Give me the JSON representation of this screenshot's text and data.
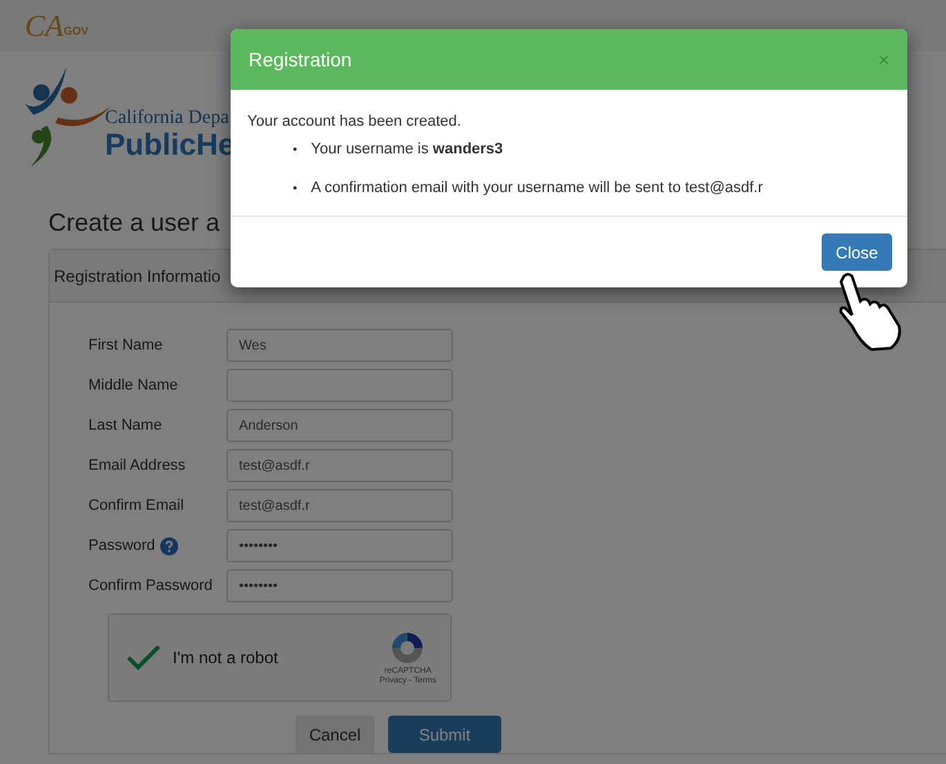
{
  "header": {
    "logo_text": "CA",
    "logo_subtext": "GOV"
  },
  "brand": {
    "line1": "California Depa",
    "line2": "PublicHe"
  },
  "page_title": "Create a user a",
  "panel": {
    "title": "Registration Informatio",
    "fields": [
      {
        "label": "First Name",
        "value": "Wes",
        "help_icon": false
      },
      {
        "label": "Middle Name",
        "help_icon": false
      },
      {
        "label": "Last Name",
        "value": "Anderson",
        "help_icon": false
      },
      {
        "label": "Email Address",
        "value": "test@asdf.r",
        "help_icon": false
      },
      {
        "label": "Confirm Email",
        "value": "test@asdf.r",
        "help_icon": false
      },
      {
        "label": "Password",
        "value": "••••••••",
        "help_icon": true
      },
      {
        "label": "Confirm Password",
        "value": "••••••••",
        "help_icon": false
      }
    ],
    "captcha": {
      "checked": true,
      "label": "I'm not a robot",
      "brand": "reCAPTCHA",
      "links": "Privacy - Terms"
    },
    "buttons": [
      {
        "label": "Cancel",
        "kind": "default"
      },
      {
        "label": "Submit",
        "kind": "primary"
      }
    ]
  },
  "modal": {
    "title": "Registration",
    "close_symbol": "×",
    "bullet": "•",
    "message": "Your account has been created.",
    "items": [
      "Your username is **wanders3**",
      "A confirmation email with your username will be sent to test@asdf.r"
    ],
    "button": "Close"
  }
}
